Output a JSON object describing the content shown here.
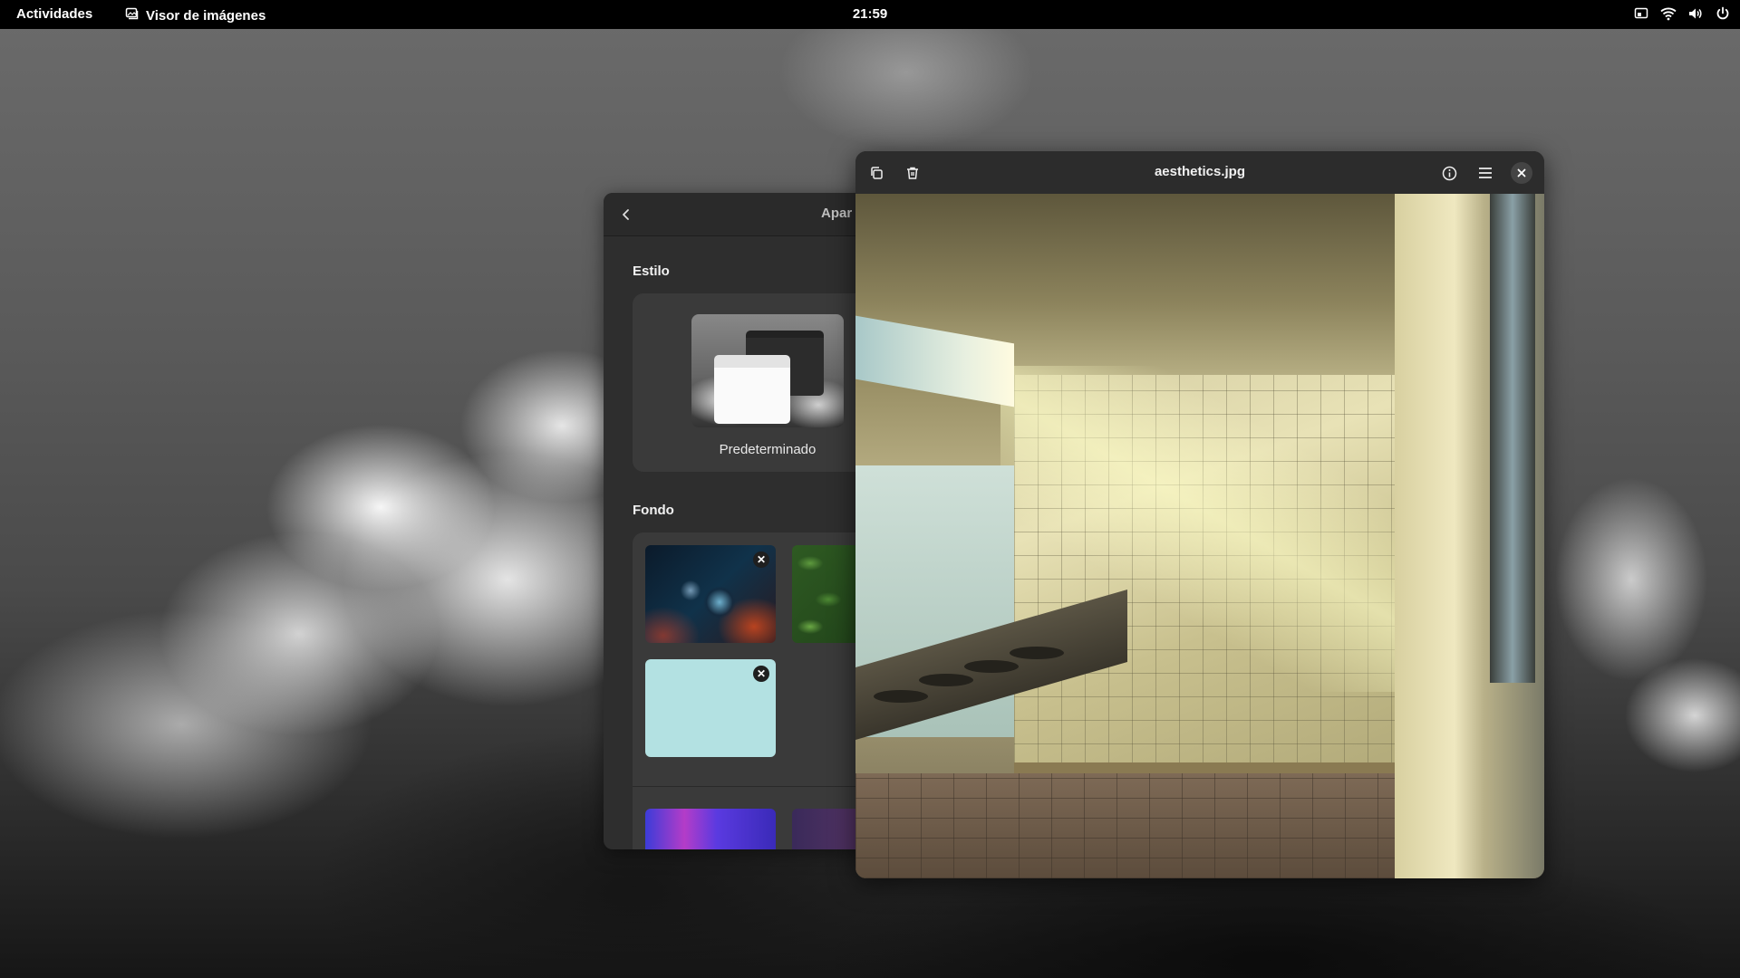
{
  "topbar": {
    "activities_label": "Actividades",
    "app_name": "Visor de imágenes",
    "clock": "21:59"
  },
  "settings": {
    "title": "Apar",
    "style_section": "Estilo",
    "style_option_label": "Predeterminado",
    "background_section": "Fondo",
    "wallpapers": [
      {
        "name": "bubbles",
        "removable": true
      },
      {
        "name": "leaves",
        "removable": false
      },
      {
        "name": "cyan",
        "removable": true
      },
      {
        "name": "purple-gradient",
        "removable": false
      },
      {
        "name": "dark-gradient",
        "removable": false
      }
    ]
  },
  "viewer": {
    "title": "aesthetics.jpg",
    "icons": [
      "copy-icon",
      "trash-icon",
      "info-icon",
      "menu-icon",
      "close-icon"
    ]
  },
  "colors": {
    "topbar_bg": "#000000",
    "window_bg": "#2e2e2e",
    "header_bg": "#2c2c2c",
    "card_bg": "#3a3a3a",
    "cyan_wallpaper": "#b3e1e2"
  }
}
